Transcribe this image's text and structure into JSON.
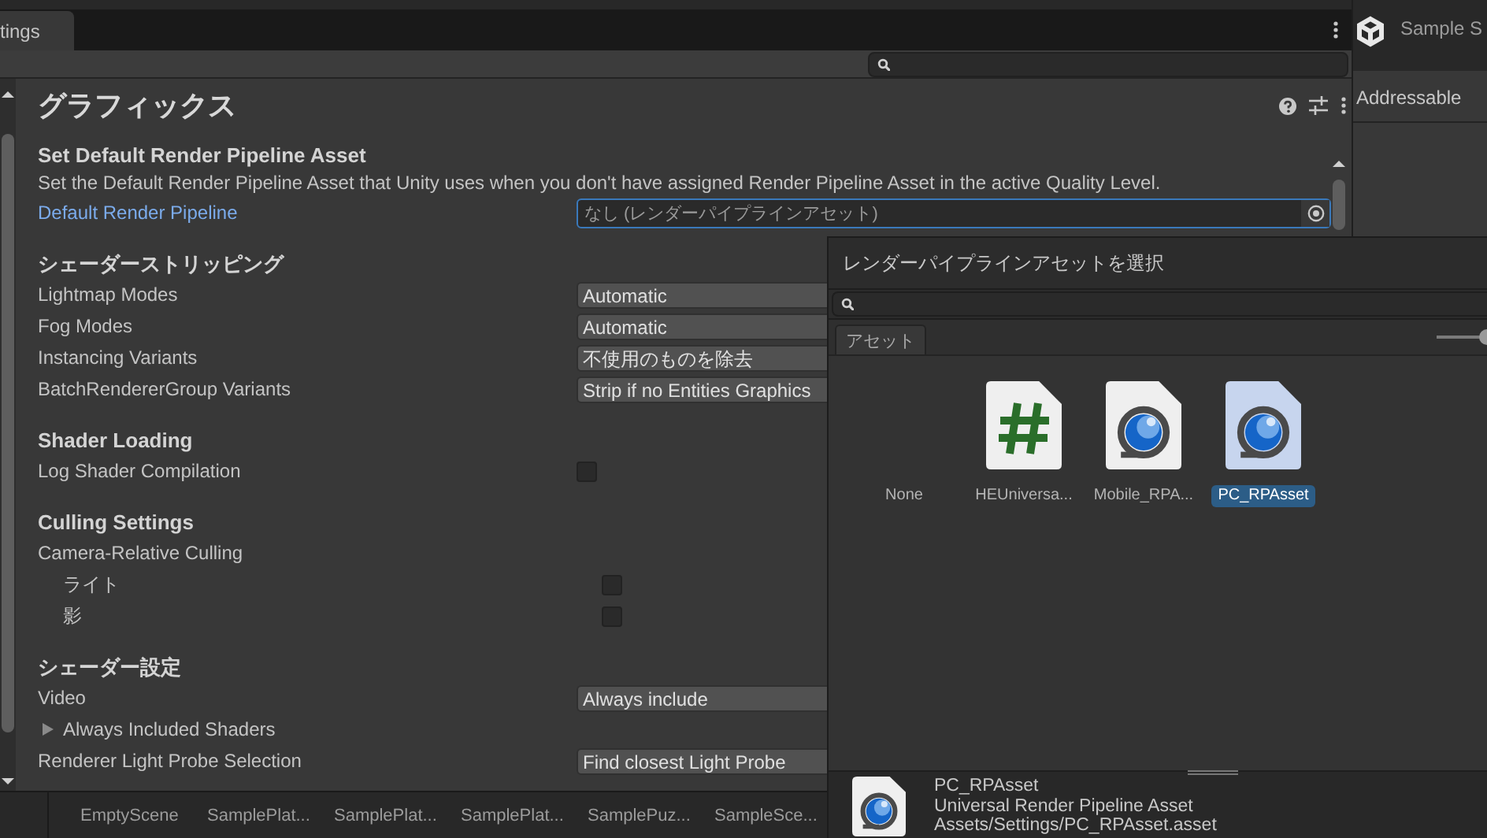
{
  "window_tab": {
    "label": "tings"
  },
  "inspector": {
    "title": "グラフィックス",
    "sections": [
      {
        "title": "Set Default Render Pipeline Asset",
        "description": "Set the Default Render Pipeline Asset that Unity uses when you don't have assigned Render Pipeline Asset in the active Quality Level.",
        "rows": [
          {
            "kind": "object",
            "label": "Default Render Pipeline",
            "value": "なし (レンダーパイプラインアセット)",
            "focused": true
          }
        ]
      },
      {
        "title": "シェーダーストリッピング",
        "rows": [
          {
            "kind": "dropdown",
            "label": "Lightmap Modes",
            "value": "Automatic"
          },
          {
            "kind": "dropdown",
            "label": "Fog Modes",
            "value": "Automatic"
          },
          {
            "kind": "dropdown",
            "label": "Instancing Variants",
            "value": "不使用のものを除去"
          },
          {
            "kind": "dropdown",
            "label": "BatchRendererGroup Variants",
            "value": "Strip if no Entities Graphics"
          }
        ]
      },
      {
        "title": "Shader Loading",
        "rows": [
          {
            "kind": "checkbox",
            "label": "Log Shader Compilation",
            "checked": false
          }
        ]
      },
      {
        "title": "Culling Settings",
        "rows": [
          {
            "kind": "label",
            "label": "Camera-Relative Culling",
            "children": [
              {
                "kind": "checkbox",
                "label": "ライト",
                "checked": false
              },
              {
                "kind": "checkbox",
                "label": "影",
                "checked": false
              }
            ]
          }
        ]
      },
      {
        "title": "シェーダー設定",
        "rows": [
          {
            "kind": "dropdown",
            "label": "Video",
            "value": "Always include"
          },
          {
            "kind": "foldout",
            "label": "Always Included Shaders",
            "expanded": false
          },
          {
            "kind": "dropdown",
            "label": "Renderer Light Probe Selection",
            "value": "Find closest Light Probe"
          }
        ]
      }
    ]
  },
  "scene_tabs": [
    {
      "label": "EmptyScene"
    },
    {
      "label": "SamplePlat..."
    },
    {
      "label": "SamplePlat..."
    },
    {
      "label": "SamplePlat..."
    },
    {
      "label": "SamplePuz..."
    },
    {
      "label": "SampleSce..."
    }
  ],
  "side_panel": {
    "title": "Sample S",
    "subtitle": "Addressable"
  },
  "picker": {
    "title": "レンダーパイプラインアセットを選択",
    "tabs": [
      {
        "label": "アセット",
        "selected": true
      }
    ],
    "zoom": {
      "level": 1
    },
    "items": [
      {
        "kind": "none",
        "name": "None",
        "selected": false
      },
      {
        "kind": "script",
        "name": "HEUniversa...",
        "selected": false
      },
      {
        "kind": "pipeline",
        "name": "Mobile_RPA...",
        "selected": false
      },
      {
        "kind": "pipeline",
        "name": "PC_RPAsset",
        "selected": true
      }
    ],
    "preview": {
      "name": "PC_RPAsset",
      "type": "Universal Render Pipeline Asset",
      "path": "Assets/Settings/PC_RPAsset.asset"
    }
  }
}
